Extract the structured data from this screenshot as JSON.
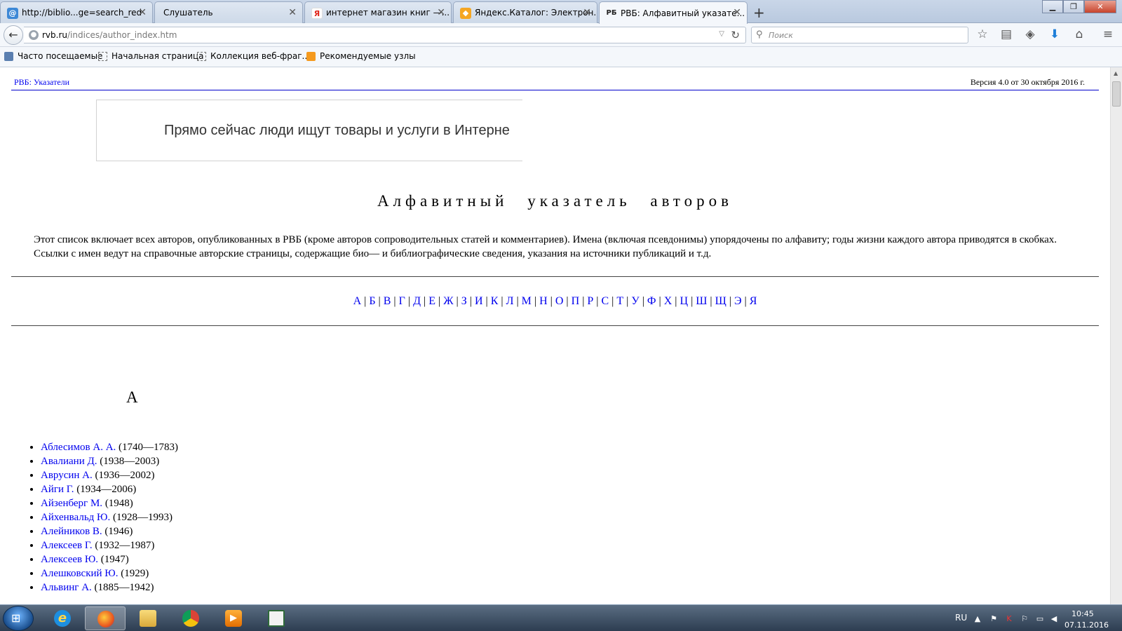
{
  "browser": {
    "tabs": [
      {
        "title": "http://biblio...ge=search_red",
        "icon": "mail-icon",
        "icon_color": "#3d88d6"
      },
      {
        "title": "Слушатель",
        "icon": "blank-page-icon",
        "icon_color": "#cfd8e4"
      },
      {
        "title": "интернет магазин книг —...",
        "icon": "yandex-icon",
        "icon_color": "#e0261b"
      },
      {
        "title": "Яндекс.Каталог: Электрон...",
        "icon": "yandex-catalog-icon",
        "icon_color": "#f5a623"
      },
      {
        "title": "РВБ: Алфавитный указате...",
        "icon": "rvb-icon",
        "icon_color": "#333333"
      }
    ],
    "new_tab": "+",
    "url_host": "rvb.ru",
    "url_path": "/indices/author_index.htm",
    "search_placeholder": "Поиск",
    "bookmarks": [
      "Часто посещаемые",
      "Начальная страница",
      "Коллекция веб-фраг...",
      "Рекомендуемые узлы"
    ]
  },
  "page": {
    "top_link": "РВБ: Указатели",
    "version": "Версия 4.0 от 30 октября 2016 г.",
    "ad_text": "Прямо сейчас люди ищут товары и услуги в Интерне",
    "title": "Алфавитный указатель авторов",
    "intro": "Этот список включает всех авторов, опубликованных в РВБ (кроме авторов сопроводительных статей и комментариев). Имена (включая псевдонимы) упорядочены по алфавиту; годы жизни каждого автора приводятся в скобках. Ссылки с имен ведут на справочные авторские страницы, содержащие био— и библиографические сведения, указания на источники публикаций и т.д.",
    "alphabet": [
      "А",
      "Б",
      "В",
      "Г",
      "Д",
      "Е",
      "Ж",
      "З",
      "И",
      "К",
      "Л",
      "М",
      "Н",
      "О",
      "П",
      "Р",
      "С",
      "Т",
      "У",
      "Ф",
      "Х",
      "Ц",
      "Ш",
      "Щ",
      "Э",
      "Я"
    ],
    "section_letter": "А",
    "authors": [
      {
        "name": "Аблесимов А. А.",
        "years": "(1740—1783)"
      },
      {
        "name": "Авалиани Д.",
        "years": "(1938—2003)"
      },
      {
        "name": "Аврусин А.",
        "years": "(1936—2002)"
      },
      {
        "name": "Айги Г.",
        "years": "(1934—2006)"
      },
      {
        "name": "Айзенберг М.",
        "years": "(1948)"
      },
      {
        "name": "Айхенвальд Ю.",
        "years": "(1928—1993)"
      },
      {
        "name": "Алейников В.",
        "years": "(1946)"
      },
      {
        "name": "Алексеев Г.",
        "years": "(1932—1987)"
      },
      {
        "name": "Алексеев Ю.",
        "years": "(1947)"
      },
      {
        "name": "Алешковский Ю.",
        "years": "(1929)"
      },
      {
        "name": "Альвинг А.",
        "years": "(1885—1942)"
      }
    ]
  },
  "taskbar": {
    "language": "RU",
    "time": "10:45",
    "date": "07.11.2016"
  },
  "colors": {
    "link": "#0000ee",
    "accent_rule": "#0000cc"
  }
}
